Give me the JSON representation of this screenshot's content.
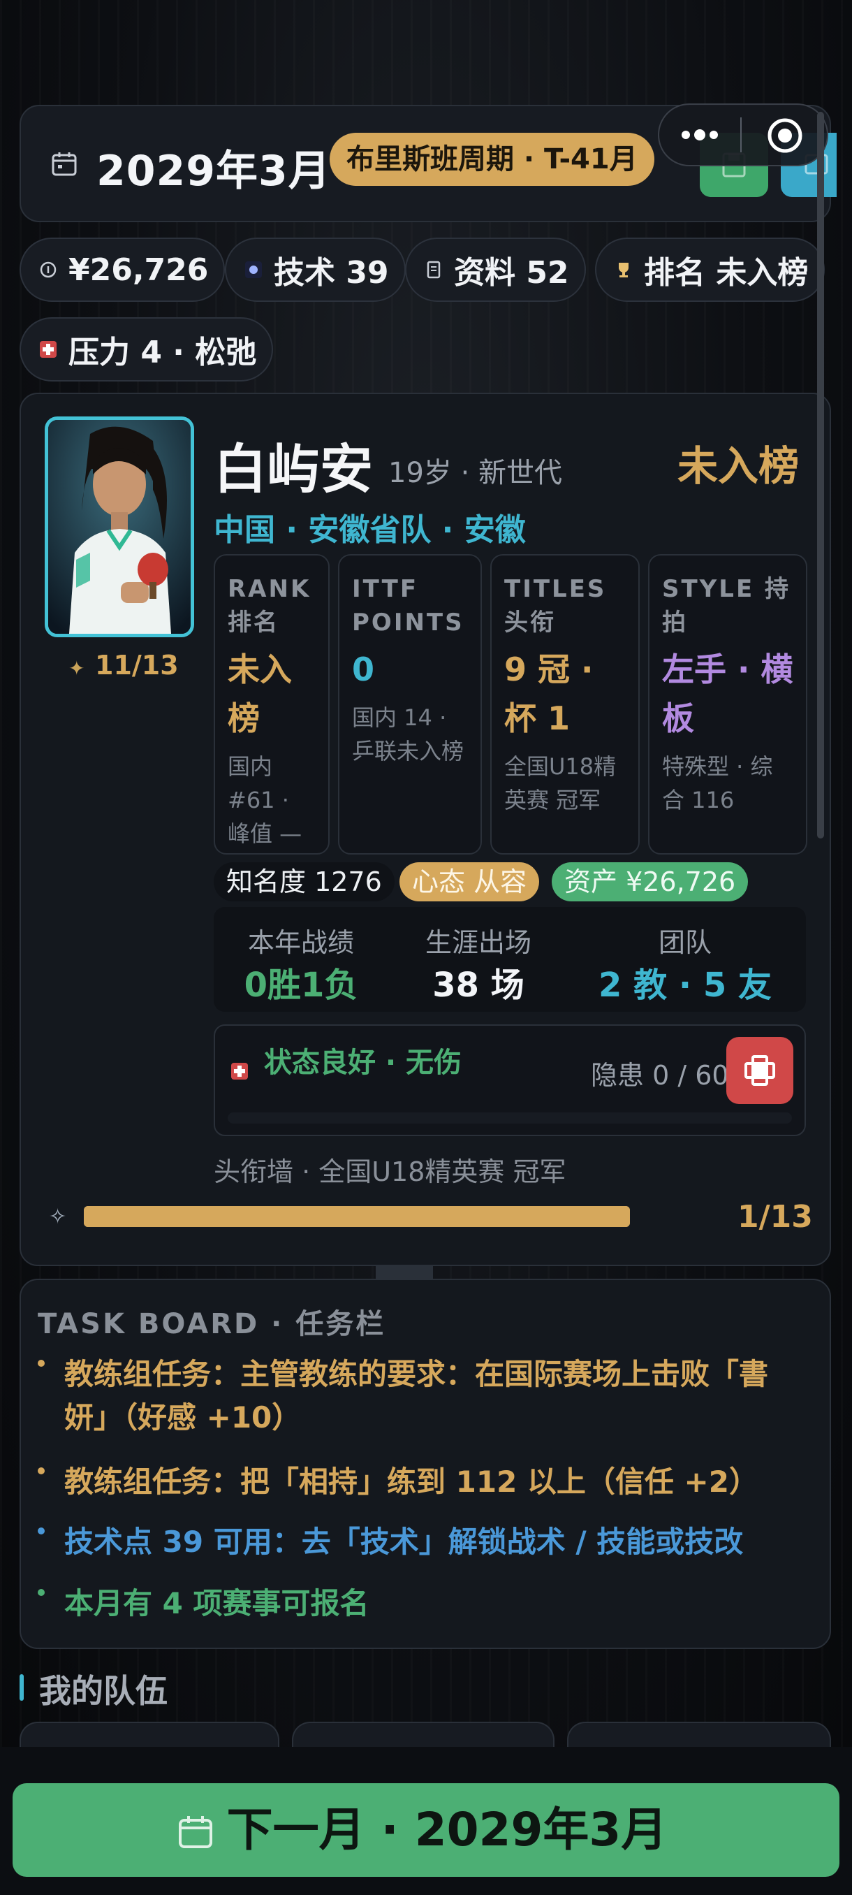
{
  "header": {
    "date": "2029年3月",
    "cycle": "布里斯班周期 · T-41月",
    "capsule_dots": "•••"
  },
  "stats": {
    "money": "¥26,726",
    "skill": "技术 39",
    "data": "资料 52",
    "rank": "排名 未入榜",
    "pressure": "压力 4 · 松弛"
  },
  "profile": {
    "name": "白屿安",
    "age_line": "19岁 · 新世代",
    "rank_status": "未入榜",
    "team_line": "中国 · 安徽省队 · 安徽",
    "portrait_counter": "11/13",
    "boxes": {
      "rank": {
        "label": "RANK 排名",
        "value": "未入榜",
        "sub": "国内 #61 · 峰值 —"
      },
      "ittf": {
        "label": "ITTF POINTS",
        "value": "0",
        "sub": "国内 14 · 乒联未入榜"
      },
      "titles": {
        "label": "TITLES 头衔",
        "value": "9 冠 · 杯 1",
        "sub": "全国U18精英赛 冠军"
      },
      "style": {
        "label": "STYLE 持拍",
        "value": "左手 · 横板",
        "sub": "特殊型 · 综合 116"
      }
    },
    "chips": {
      "fame": "知名度 1276",
      "mood": "心态 从容",
      "assets": "资产 ¥26,726"
    },
    "record": {
      "year_label": "本年战绩",
      "year_value": "0胜1负",
      "career_label": "生涯出场",
      "career_value": "38 场",
      "team_label": "团队",
      "team_value": "2 教 · 5 友"
    },
    "health": {
      "status": "状态良好 · 无伤",
      "hidden": "隐患 0 / 60"
    },
    "title_wall": "头衔墙 · 全国U18精英赛 冠军",
    "progress_label": "1/13",
    "progress": 1.0
  },
  "task_board": {
    "title": "TASK BOARD · 任务栏",
    "items": [
      {
        "text": "教练组任务：主管教练的要求：在国际赛场上击败「書妍」（好感 +10）",
        "color": "#d6a85c"
      },
      {
        "text": "教练组任务：把「相持」练到 112 以上（信任 +2）",
        "color": "#d6a85c"
      },
      {
        "text": "技术点 39 可用：去「技术」解锁战术 / 技能或技改",
        "color": "#4a98d8"
      },
      {
        "text": "本月有 4 项赛事可报名",
        "color": "#4caf74"
      }
    ]
  },
  "section": {
    "my_team": "我的队伍"
  },
  "footer": {
    "next_button": "下一月 · 2029年3月"
  },
  "colors": {
    "gold": "#d6a85c",
    "green": "#4caf74",
    "cyan": "#3fb6d0",
    "purple": "#b28ae0",
    "red": "#d04848"
  }
}
